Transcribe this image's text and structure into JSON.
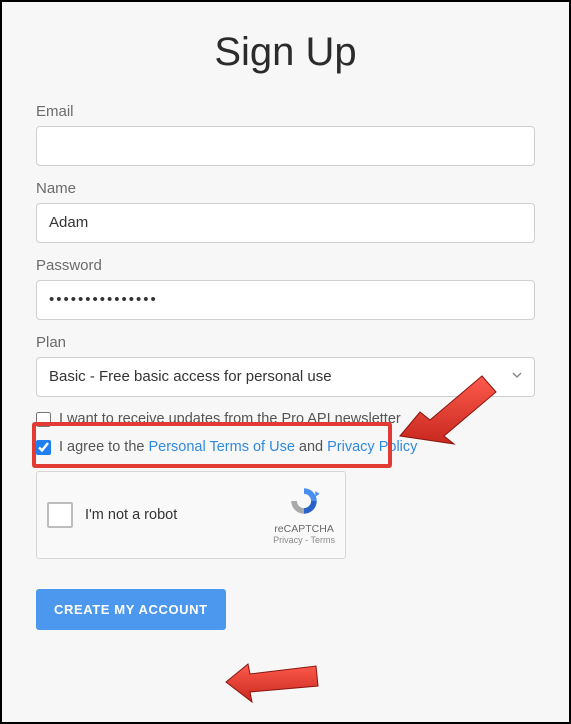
{
  "title": "Sign Up",
  "fields": {
    "email": {
      "label": "Email",
      "value": ""
    },
    "name": {
      "label": "Name",
      "value": "Adam"
    },
    "password": {
      "label": "Password",
      "value": "•••••••••••••••"
    },
    "plan": {
      "label": "Plan",
      "selected": "Basic - Free basic access for personal use"
    }
  },
  "checkboxes": {
    "newsletter": {
      "checked": false,
      "label": "I want to receive updates from the Pro API newsletter"
    },
    "terms": {
      "checked": true,
      "prefix": "I agree to the ",
      "terms_link": "Personal Terms of Use",
      "connector": " and ",
      "privacy_link": "Privacy Policy"
    }
  },
  "recaptcha": {
    "label": "I'm not a robot",
    "brand": "reCAPTCHA",
    "privacy": "Privacy",
    "terms": "Terms",
    "separator": " - "
  },
  "submit_label": "Create My Account"
}
